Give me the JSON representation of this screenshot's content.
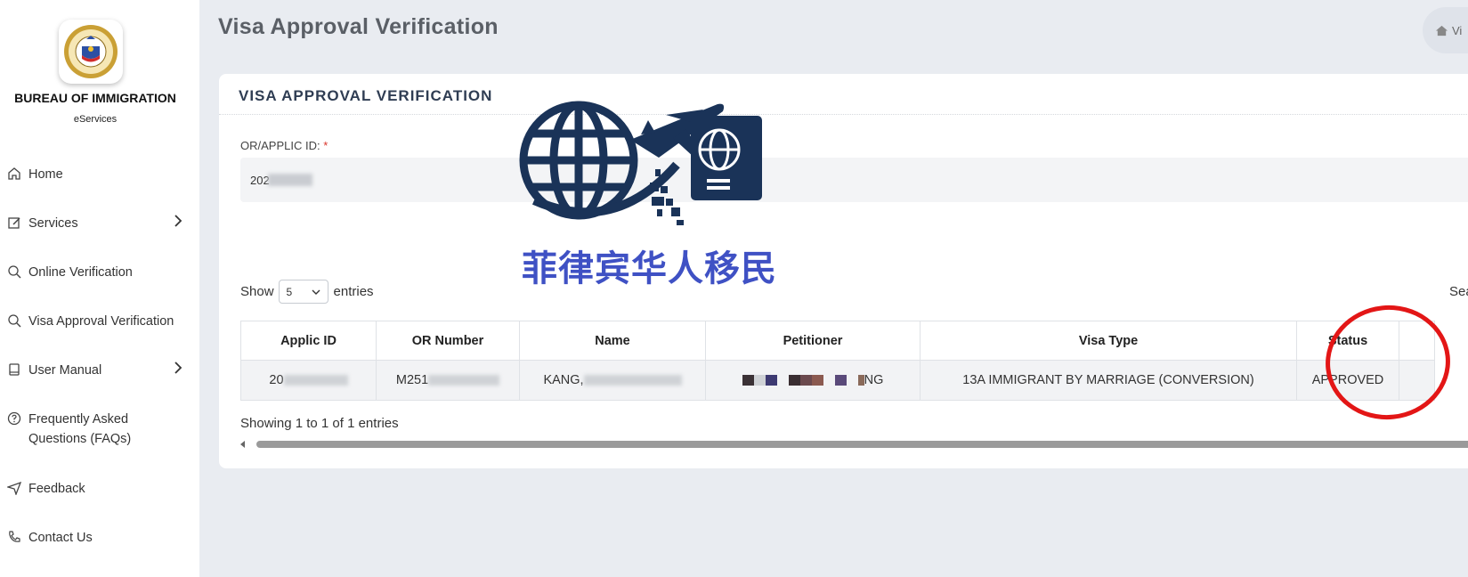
{
  "brand": {
    "title": "BUREAU OF IMMIGRATION",
    "subtitle": "eServices"
  },
  "sidebar": {
    "items": [
      {
        "label": "Home",
        "icon": "home-icon"
      },
      {
        "label": "Services",
        "icon": "edit-icon",
        "has_submenu": true
      },
      {
        "label": "Online Verification",
        "icon": "search-icon"
      },
      {
        "label": "Visa Approval Verification",
        "icon": "search-icon"
      },
      {
        "label": "User Manual",
        "icon": "book-icon",
        "has_submenu": true
      },
      {
        "label": "Frequently Asked Questions (FAQs)",
        "icon": "help-circle-icon"
      },
      {
        "label": "Feedback",
        "icon": "send-icon"
      },
      {
        "label": "Contact Us",
        "icon": "phone-icon"
      }
    ]
  },
  "header": {
    "page_title": "Visa Approval Verification",
    "breadcrumb": "Vi"
  },
  "card": {
    "title": "VISA APPROVAL VERIFICATION",
    "field_label": "OR/APPLIC ID: ",
    "field_required_mark": "*",
    "field_value": "202"
  },
  "table_controls": {
    "show_label": "Show",
    "page_size": "5",
    "entries_label": "entries",
    "search_label": "Sea"
  },
  "table": {
    "columns": [
      "Applic ID",
      "OR Number",
      "Name",
      "Petitioner",
      "Visa Type",
      "Status"
    ],
    "rows": [
      {
        "applic_id": "20",
        "or_number": "M251",
        "name": "KANG,",
        "petitioner": "NG",
        "visa_type": "13A IMMIGRANT BY MARRIAGE (CONVERSION)",
        "status": "APPROVED"
      }
    ]
  },
  "footer_info": "Showing 1 to 1 of 1 entries",
  "watermark": {
    "text": "菲律宾华人移民"
  },
  "colors": {
    "accent_ring": "#e31616",
    "watermark_navy": "#1a3358",
    "watermark_text": "#3f51c4",
    "card_title": "#2f3d53"
  }
}
